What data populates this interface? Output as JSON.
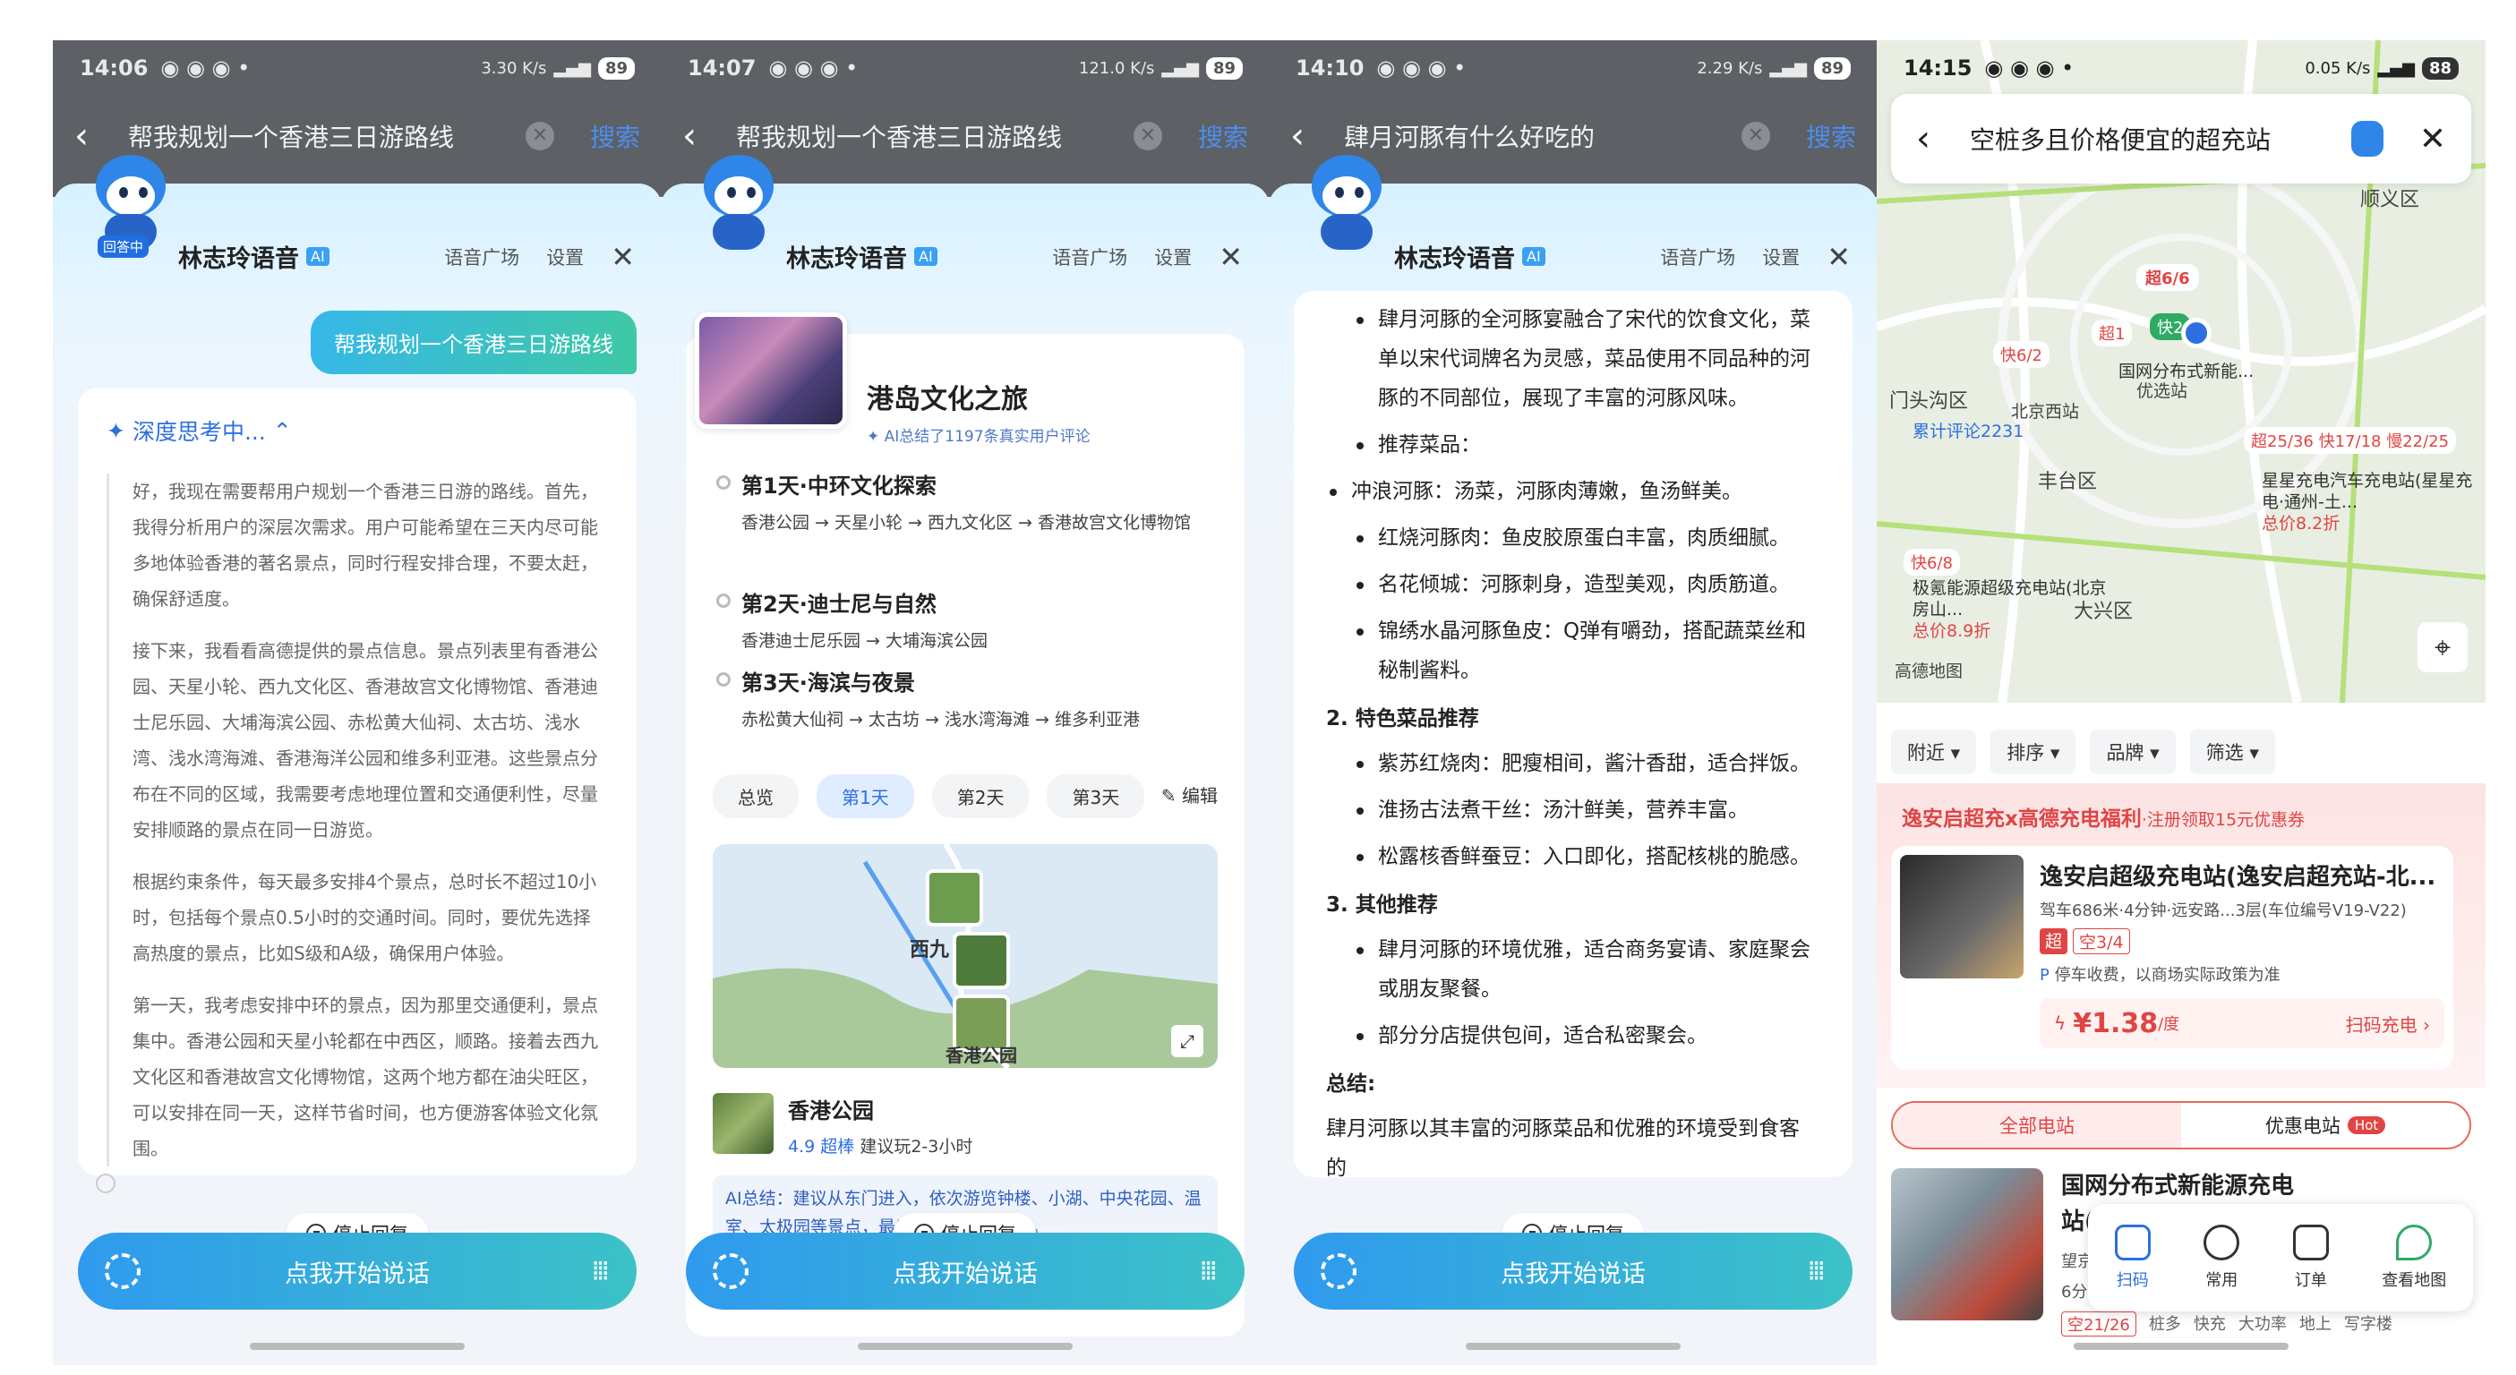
{
  "screens": [
    {
      "status": {
        "time": "14:06",
        "battery": "89",
        "net": "3.30 K/s"
      },
      "search": {
        "query": "帮我规划一个香港三日游路线",
        "go": "搜索"
      },
      "assistant": {
        "name": "林志玲语音",
        "ai": "AI",
        "plaza": "语音广场",
        "settings": "设置",
        "state_tag": "回答中"
      },
      "user_bubble": "帮我规划一个香港三日游路线",
      "thinking": {
        "title": "深度思考中...",
        "paragraphs": [
          "好，我现在需要帮用户规划一个香港三日游的路线。首先，我得分析用户的深层次需求。用户可能希望在三天内尽可能多地体验香港的著名景点，同时行程安排合理，不要太赶，确保舒适度。",
          "接下来，我看看高德提供的景点信息。景点列表里有香港公园、天星小轮、西九文化区、香港故宫文化博物馆、香港迪士尼乐园、大埔海滨公园、赤松黄大仙祠、太古坊、浅水湾、浅水湾海滩、香港海洋公园和维多利亚港。这些景点分布在不同的区域，我需要考虑地理位置和交通便利性，尽量安排顺路的景点在同一日游览。",
          "根据约束条件，每天最多安排4个景点，总时长不超过10小时，包括每个景点0.5小时的交通时间。同时，要优先选择高热度的景点，比如S级和A级，确保用户体验。",
          "第一天，我考虑安排中环的景点，因为那里交通便利，景点集中。香港公园和天星小轮都在中西区，顺路。接着去西九文化区和香港故宫文化博物馆，这两个地方都在油尖旺区，可以安排在同一天，这样节省时间，也方便游客体验文化氛围。"
        ]
      },
      "stop": "停止回复",
      "talk": "点我开始说话"
    },
    {
      "status": {
        "time": "14:07",
        "battery": "89",
        "net": "121.0 K/s"
      },
      "search": {
        "query": "帮我规划一个香港三日游路线",
        "go": "搜索"
      },
      "assistant": {
        "name": "林志玲语音",
        "ai": "AI",
        "plaza": "语音广场",
        "settings": "设置"
      },
      "trip": {
        "title": "港岛文化之旅",
        "summary": "AI总结了1197条真实用户评论",
        "days": [
          {
            "title": "第1天·中环文化探索",
            "route": "香港公园 → 天星小轮 → 西九文化区 → 香港故宫文化博物馆"
          },
          {
            "title": "第2天·迪士尼与自然",
            "route": "香港迪士尼乐园 → 大埔海滨公园"
          },
          {
            "title": "第3天·海滨与夜景",
            "route": "赤松黄大仙祠 → 太古坊 → 浅水湾海滩 → 维多利亚港"
          }
        ],
        "tabs": [
          "总览",
          "第1天",
          "第2天",
          "第3天"
        ],
        "edit": "编辑",
        "map_labels": [
          "西九",
          "香港公园"
        ],
        "poi": {
          "name": "香港公园",
          "score": "4.9",
          "grade": "超棒",
          "suggest": "建议玩2-3小时"
        },
        "ai_summary": "AI总结：建议从东门进入，依次游览钟楼、小湖、中央花园、温室、太极园等景点，最后参观茶具文物馆。"
      },
      "stop": "停止回复",
      "talk": "点我开始说话"
    },
    {
      "status": {
        "time": "14:10",
        "battery": "89",
        "net": "2.29 K/s"
      },
      "search": {
        "query": "肆月河豚有什么好吃的",
        "go": "搜索"
      },
      "assistant": {
        "name": "林志玲语音",
        "ai": "AI",
        "plaza": "语音广场",
        "settings": "设置"
      },
      "answer": {
        "top_bullets": [
          "肆月河豚的全河豚宴融合了宋代的饮食文化，菜单以宋代词牌名为灵感，菜品使用不同品种的河豚的不同部位，展现了丰富的河豚风味。",
          "推荐菜品："
        ],
        "recommend": [
          "冲浪河豚：汤菜，河豚肉薄嫩，鱼汤鲜美。",
          "红烧河豚肉：鱼皮胶原蛋白丰富，肉质细腻。",
          "名花倾城：河豚刺身，造型美观，肉质筋道。",
          "锦绣水晶河豚鱼皮：Q弹有嚼劲，搭配蔬菜丝和秘制酱料。"
        ],
        "h2": "2. 特色菜品推荐",
        "featured": [
          "紫苏红烧肉：肥瘦相间，酱汁香甜，适合拌饭。",
          "淮扬古法煮干丝：汤汁鲜美，营养丰富。",
          "松露核香鲜蚕豆：入口即化，搭配核桃的脆感。"
        ],
        "h3": "3. 其他推荐",
        "other": [
          "肆月河豚的环境优雅，适合商务宴请、家庭聚会或朋友聚餐。",
          "部分分店提供包间，适合私密聚会。"
        ],
        "summary_h": "总结:",
        "summary": "肆月河豚以其丰富的河豚菜品和优雅的环境受到食客的"
      },
      "stop": "停止回复",
      "talk": "点我开始说话"
    },
    {
      "status": {
        "time": "14:15",
        "battery": "88",
        "net": "0.05 K/s"
      },
      "search": {
        "query": "空桩多且价格便宜的超充站"
      },
      "map": {
        "labels": [
          "顺义区",
          "门头沟区",
          "北京西站",
          "丰台区",
          "大兴区",
          "优选站",
          "累计评论2231",
          "高德地图"
        ],
        "pins": [
          "超6/6",
          "超1",
          "快2",
          "快6/2",
          "快6/8",
          "超25/36 快17/18 慢22/25"
        ],
        "station_a": "国网分布式新能...",
        "station_b": {
          "name": "星星充电汽车充电站(星星充电·通州-土...",
          "price": "总价8.2折"
        },
        "station_c": {
          "name": "极氪能源超级充电站(北京房山...",
          "price": "总价8.9折"
        }
      },
      "filters": [
        "附近",
        "排序",
        "品牌",
        "筛选"
      ],
      "promo": {
        "title": "逸安启超充x高德充电福利",
        "sub": "·注册领取15元优惠券",
        "station": {
          "name": "逸安启超级充电站(逸安启超充站-北...",
          "meta": "驾车686米·4分钟·远安路...3层(车位编号V19-V22)",
          "badge": "超",
          "slots": "空3/4",
          "parking": "停车收费，以商场实际政策为准",
          "price": "¥1.38",
          "unit": "/度",
          "action": "扫码充电"
        }
      },
      "segment": {
        "all": "全部电站",
        "offer": "优惠电站",
        "hot": "Hot"
      },
      "bottom_station": {
        "name": "国网分布式新能源充电站(望京卷石天地",
        "meta1": "望京",
        "meta2": "6分钟",
        "slots": "空21/26",
        "tags": [
          "桩多",
          "快充",
          "大功率",
          "地上",
          "写字楼"
        ]
      },
      "quick_actions": [
        "扫码",
        "常用",
        "订单",
        "查看地图"
      ]
    }
  ]
}
